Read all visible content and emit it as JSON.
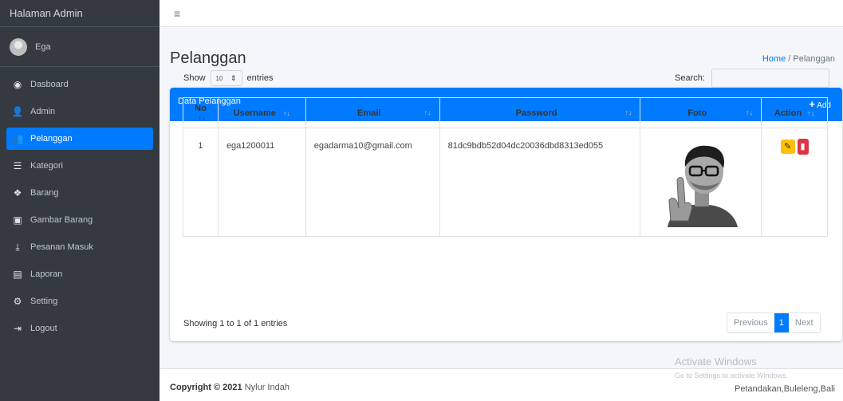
{
  "sidebar": {
    "brand": "Halaman Admin",
    "user": "Ega",
    "items": [
      {
        "label": "Dasboard",
        "icon": "dashboard-icon"
      },
      {
        "label": "Admin",
        "icon": "user-icon"
      },
      {
        "label": "Pelanggan",
        "icon": "users-icon",
        "active": true
      },
      {
        "label": "Kategori",
        "icon": "list-icon"
      },
      {
        "label": "Barang",
        "icon": "box-icon"
      },
      {
        "label": "Gambar Barang",
        "icon": "image-icon"
      },
      {
        "label": "Pesanan Masuk",
        "icon": "download-icon"
      },
      {
        "label": "Laporan",
        "icon": "file-icon"
      },
      {
        "label": "Setting",
        "icon": "gear-icon"
      },
      {
        "label": "Logout",
        "icon": "logout-icon"
      }
    ]
  },
  "header": {
    "title": "Pelanggan",
    "breadcrumb_home": "Home",
    "breadcrumb_sep": "/",
    "breadcrumb_current": "Pelanggan"
  },
  "card": {
    "title": "Data Pelanggan",
    "add_label": "Add"
  },
  "table_controls": {
    "show_label": "Show",
    "entries_value": "10",
    "entries_label": "entries",
    "search_label": "Search:"
  },
  "table": {
    "columns": [
      "No",
      "Username",
      "Email",
      "Password",
      "Foto",
      "Action"
    ],
    "rows": [
      {
        "no": "1",
        "username": "ega1200011",
        "email": "egadarma10@gmail.com",
        "password": "81dc9bdb52d04dc20036dbd8313ed055"
      }
    ]
  },
  "pagination": {
    "info": "Showing 1 to 1 of 1 entries",
    "previous": "Previous",
    "page": "1",
    "next": "Next"
  },
  "footer": {
    "copyright_prefix": "Copyright © 2021",
    "author": "Nylur Indah",
    "location": "Petandakan,Buleleng,Bali"
  },
  "watermark": {
    "line1": "Activate Windows",
    "line2": "Go to Settings to activate Windows."
  },
  "colors": {
    "primary": "#007bff",
    "sidebar": "#343a40",
    "warning": "#ffc107",
    "danger": "#dc3545"
  }
}
